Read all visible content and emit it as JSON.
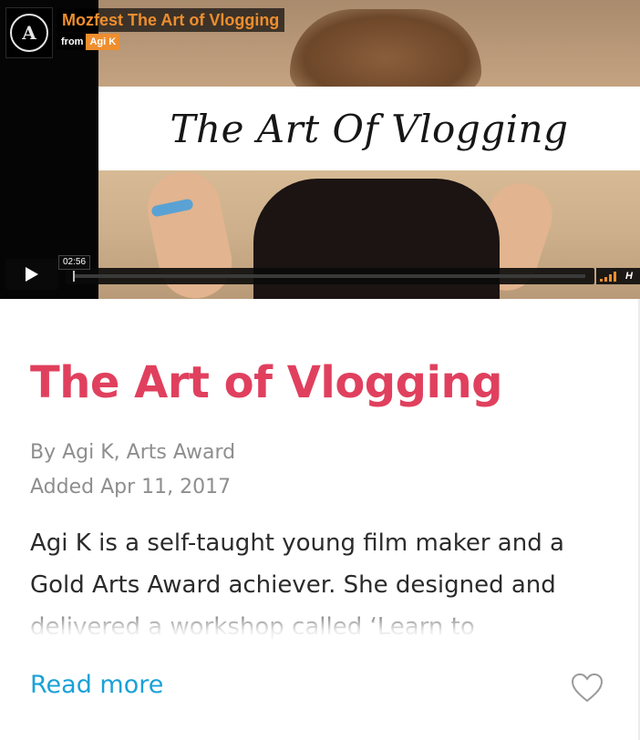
{
  "video": {
    "title": "Mozfest The Art of Vlogging",
    "from_label": "from",
    "author": "Agi K",
    "thumbnail_text": "The Art Of Vlogging",
    "badge_letter": "A",
    "timestamp": "02:56",
    "hd_label": "H",
    "accent_color": "#ee8e2e",
    "icons": {
      "play": "play-icon",
      "volume": "volume-icon"
    }
  },
  "card": {
    "title": "The Art of Vlogging",
    "byline": "By Agi K, Arts Award",
    "added": "Added Apr 11, 2017",
    "description": "Agi K is a self-taught young film maker and a Gold Arts Award achiever. She designed and delivered a workshop called ‘Learn to",
    "read_more": "Read more",
    "favorite_icon": "heart-icon",
    "title_color": "#e0405e",
    "link_color": "#1aa1d8"
  }
}
